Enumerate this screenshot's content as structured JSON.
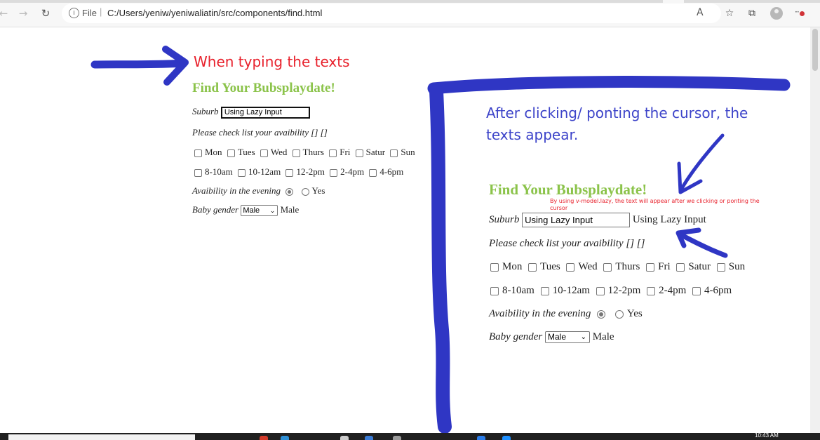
{
  "browser": {
    "url_prefix": "File",
    "url_separator": "|",
    "url": "C:/Users/yeniw/yeniwaliatin/src/components/find.html",
    "icons": [
      "back-icon",
      "forward-icon",
      "refresh-icon",
      "info-icon",
      "read-aloud-icon",
      "favorites-icon",
      "collections-icon",
      "profile-icon",
      "more-icon"
    ]
  },
  "annotations": {
    "left_caption": "When typing the texts",
    "right_caption": "After clicking/ ponting the cursor, the texts appear.",
    "note": "By using v-model.lazy, the text will appear after we clicking or ponting the cursor",
    "colors": {
      "red": "#e8212c",
      "marker_blue": "#2f36c4",
      "caption_blue": "#3d44c9"
    }
  },
  "form_typing": {
    "title": "Find Your Bubsplaydate!",
    "suburb_label": "Suburb",
    "suburb_value": "Using Lazy Input",
    "suburb_echo": "",
    "availability_label": "Please check list your avaibility [] []",
    "days": [
      "Mon",
      "Tues",
      "Wed",
      "Thurs",
      "Fri",
      "Satur",
      "Sun"
    ],
    "times": [
      "8-10am",
      "10-12am",
      "12-2pm",
      "2-4pm",
      "4-6pm"
    ],
    "evening_label": "Avaibility in the evening",
    "evening_option": "Yes",
    "gender_label": "Baby gender",
    "gender_selected": "Male",
    "gender_echo": "Male"
  },
  "form_after": {
    "title": "Find Your Bubsplaydate!",
    "suburb_label": "Suburb",
    "suburb_value": "Using Lazy Input",
    "suburb_echo": "Using Lazy Input",
    "availability_label": "Please check list your avaibility [] []",
    "days": [
      "Mon",
      "Tues",
      "Wed",
      "Thurs",
      "Fri",
      "Satur",
      "Sun"
    ],
    "times": [
      "8-10am",
      "10-12am",
      "12-2pm",
      "2-4pm",
      "4-6pm"
    ],
    "evening_label": "Avaibility in the evening",
    "evening_option": "Yes",
    "gender_label": "Baby gender",
    "gender_selected": "Male",
    "gender_echo": "Male"
  },
  "taskbar": {
    "clock": "10:43 AM"
  }
}
